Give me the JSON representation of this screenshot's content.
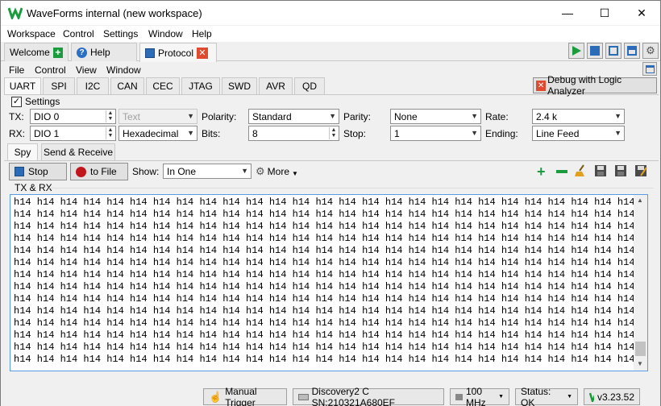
{
  "window": {
    "title": "WaveForms internal (new workspace)",
    "min": "—",
    "max": "☐",
    "close": "✕"
  },
  "menu": [
    "Workspace",
    "Control",
    "Settings",
    "Window",
    "Help"
  ],
  "tabs": {
    "welcome": "Welcome",
    "help": "Help",
    "protocol": "Protocol"
  },
  "submenu": [
    "File",
    "Control",
    "View",
    "Window"
  ],
  "protocols": [
    "UART",
    "SPI",
    "I2C",
    "CAN",
    "CEC",
    "JTAG",
    "SWD",
    "AVR",
    "QD"
  ],
  "debug_button": "Debug with Logic Analyzer",
  "settings": {
    "checkbox_label": "Settings",
    "tx_label": "TX:",
    "tx_value": "DIO 0",
    "rx_label": "RX:",
    "rx_value": "DIO 1",
    "tx_format": "Text",
    "rx_format": "Hexadecimal",
    "polarity_label": "Polarity:",
    "polarity_value": "Standard",
    "bits_label": "Bits:",
    "bits_value": "8",
    "parity_label": "Parity:",
    "parity_value": "None",
    "stop_label": "Stop:",
    "stop_value": "1",
    "rate_label": "Rate:",
    "rate_value": "2.4 k",
    "ending_label": "Ending:",
    "ending_value": "Line Feed"
  },
  "subtabs": {
    "spy": "Spy",
    "send_receive": "Send & Receive"
  },
  "toolbar": {
    "stop": "Stop",
    "to_file": "to File",
    "show_label": "Show:",
    "show_value": "In One",
    "more": "More"
  },
  "group_title": "TX & RX",
  "console": {
    "token": "h14",
    "cols": 28,
    "full_rows": 13,
    "last_row_count": 27
  },
  "statusbar": {
    "trigger": "Manual Trigger",
    "device": "Discovery2 C SN:210321A680EF",
    "freq": "100 MHz",
    "status": "Status: OK",
    "version": "v3.23.52"
  },
  "colors": {
    "accent": "#1a9c3e",
    "selection_border": "#569de5",
    "close_red": "#e04a30",
    "record_red": "#c0161b"
  }
}
